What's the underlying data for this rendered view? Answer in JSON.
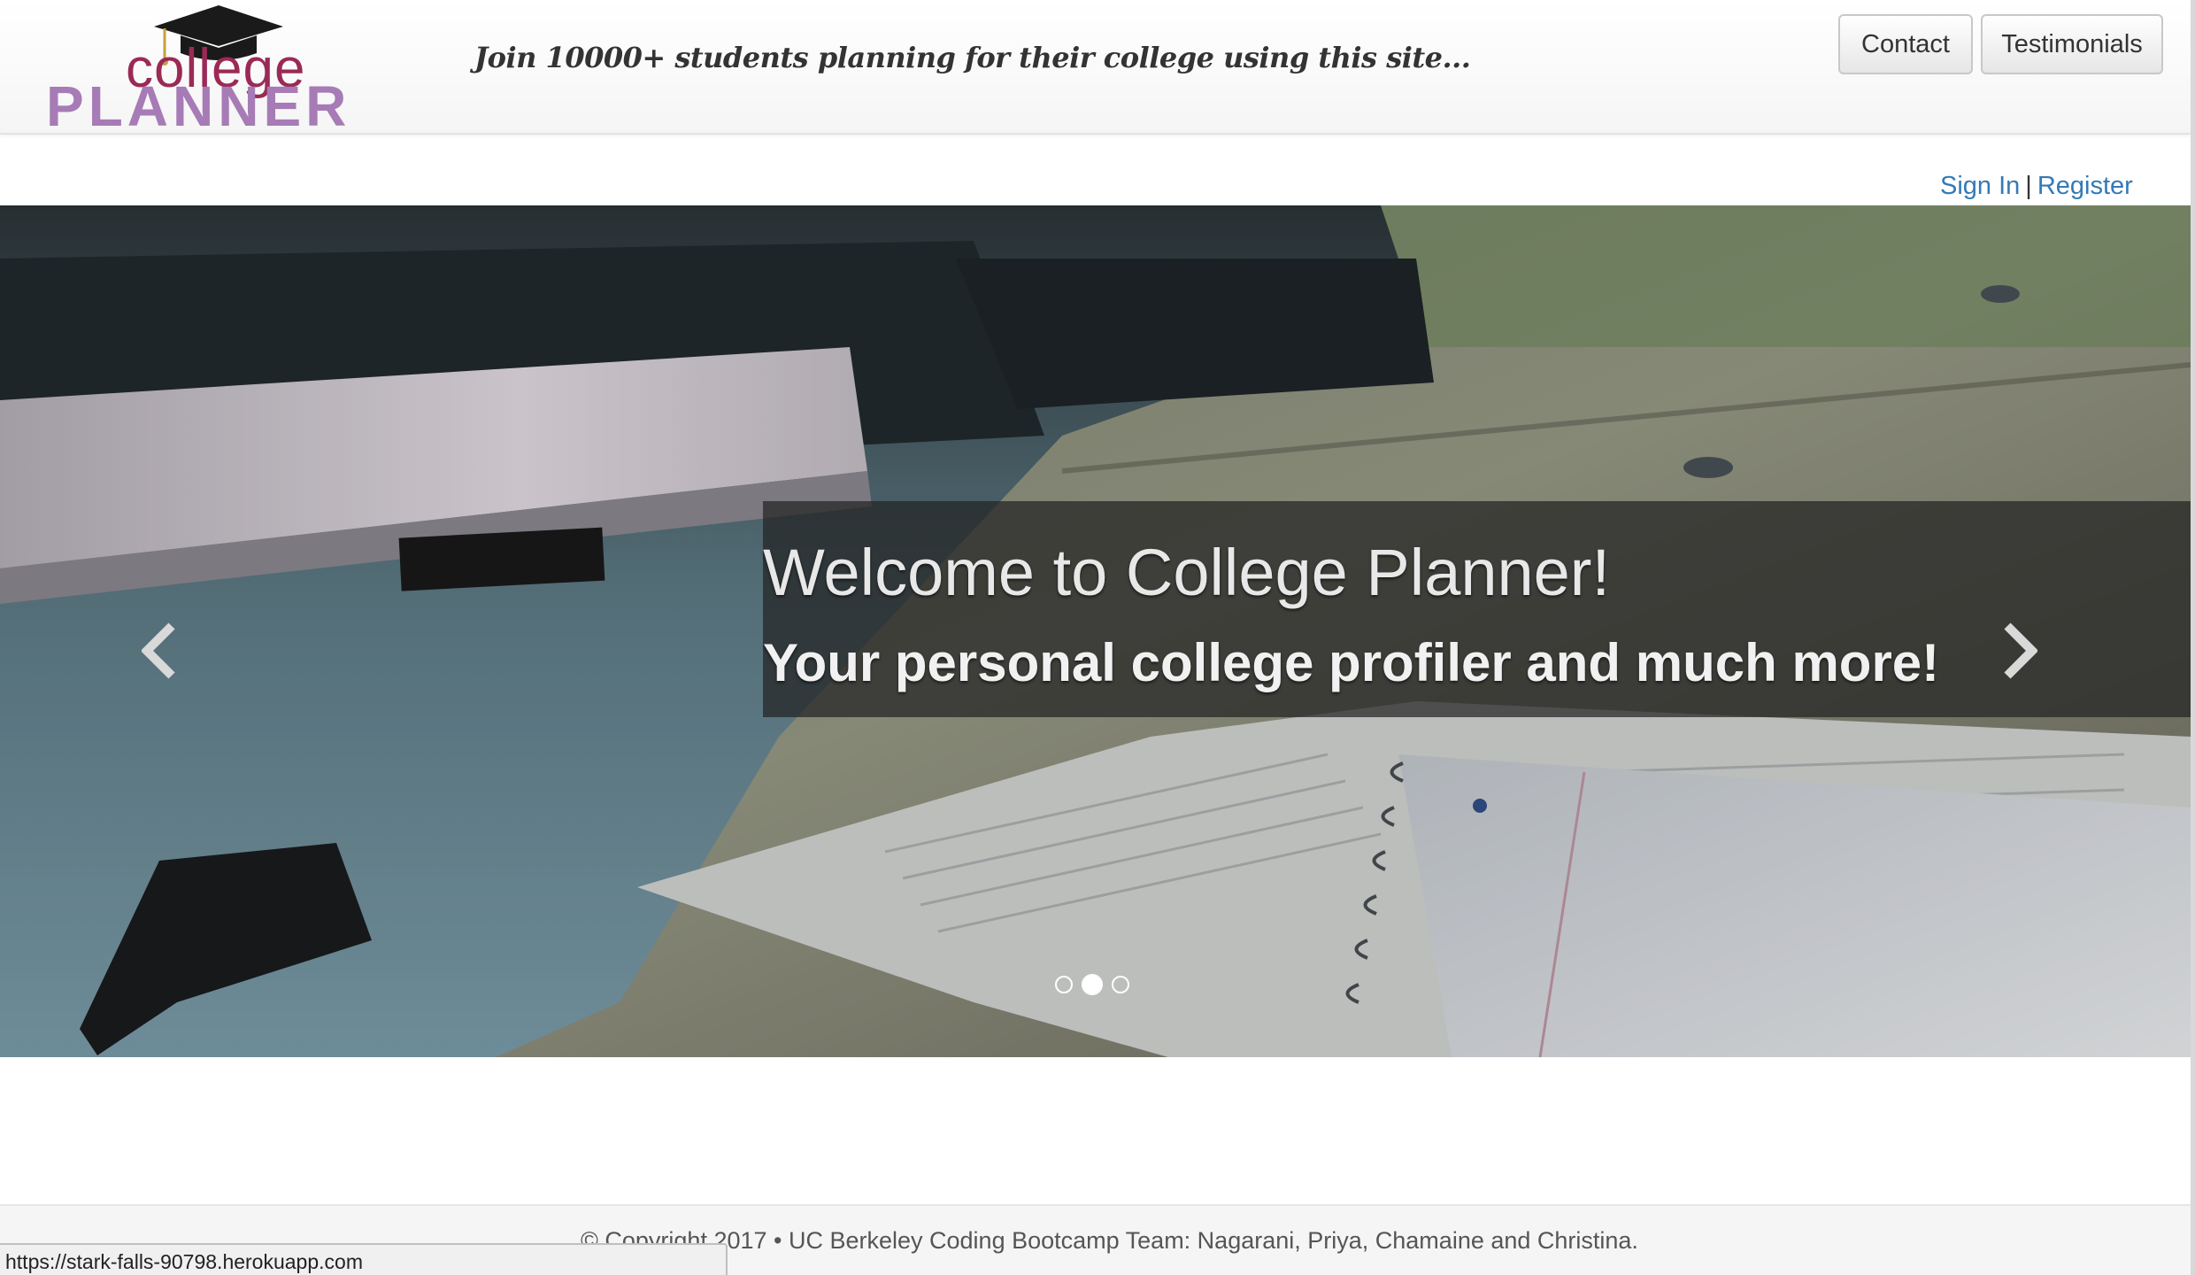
{
  "header": {
    "logo": {
      "line1": "college",
      "line2": "PLANNER"
    },
    "tagline": "Join 10000+ students planning for their college using this site...",
    "nav_buttons": {
      "contact": "Contact",
      "testimonials": "Testimonials"
    }
  },
  "auth": {
    "sign_in": "Sign In",
    "separator": "|",
    "register": "Register"
  },
  "carousel": {
    "title": "Welcome to College Planner!",
    "subtitle": "Your personal college profiler and much more!",
    "prev_icon": "chevron-left-icon",
    "next_icon": "chevron-right-icon",
    "slide_count": 3,
    "active_slide": 2
  },
  "footer": {
    "text": "© Copyright 2017 • UC Berkeley Coding Bootcamp Team: Nagarani, Priya, Chamaine and Christina."
  },
  "status_bar": {
    "url": "https://stark-falls-90798.herokuapp.com"
  },
  "colors": {
    "link": "#337ab7",
    "logo_college": "#9a2a55",
    "logo_planner": "#a77bb6"
  }
}
